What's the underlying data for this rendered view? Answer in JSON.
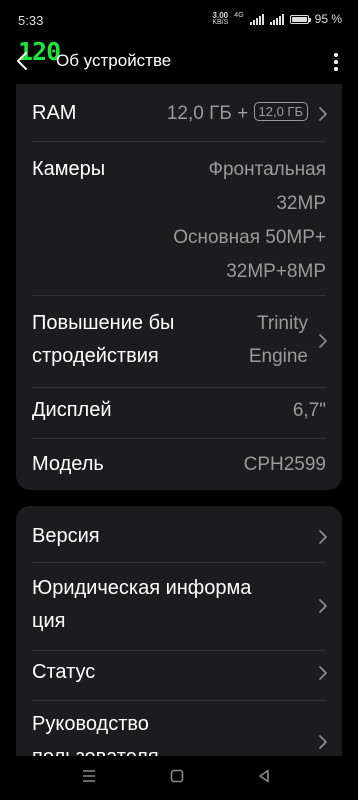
{
  "status_bar": {
    "time": "5:33",
    "net_speed_value": "3.00",
    "net_speed_unit": "KB/S",
    "network_type": "4G",
    "battery_percent": "95 %"
  },
  "fps_counter": "120",
  "header": {
    "title": "Об устройстве"
  },
  "specs": {
    "ram": {
      "label": "RAM",
      "value": "12,0 ГБ +",
      "badge": "12,0 ГБ"
    },
    "cameras": {
      "label": "Камеры",
      "front_line1": "Фронтальная",
      "front_line2": "32MP",
      "main_line1": "Основная 50MP+",
      "main_line2": "32MP+8MP"
    },
    "performance": {
      "label_line1": "Повышение бы",
      "label_line2": "стродействия",
      "value_line1": "Trinity",
      "value_line2": "Engine"
    },
    "display": {
      "label": "Дисплей",
      "value": "6,7\""
    },
    "model": {
      "label": "Модель",
      "value": "CPH2599"
    }
  },
  "info": {
    "version": {
      "label": "Версия"
    },
    "legal": {
      "label_line1": "Юридическая информа",
      "label_line2": "ция"
    },
    "status": {
      "label": "Статус"
    },
    "guide": {
      "label_line1": "Руководство",
      "label_line2": "пользователя"
    }
  },
  "colors": {
    "background": "#000000",
    "card": "#1c1c1e",
    "secondary_text": "#9a9a9a",
    "fps_green": "#1ee63c"
  }
}
